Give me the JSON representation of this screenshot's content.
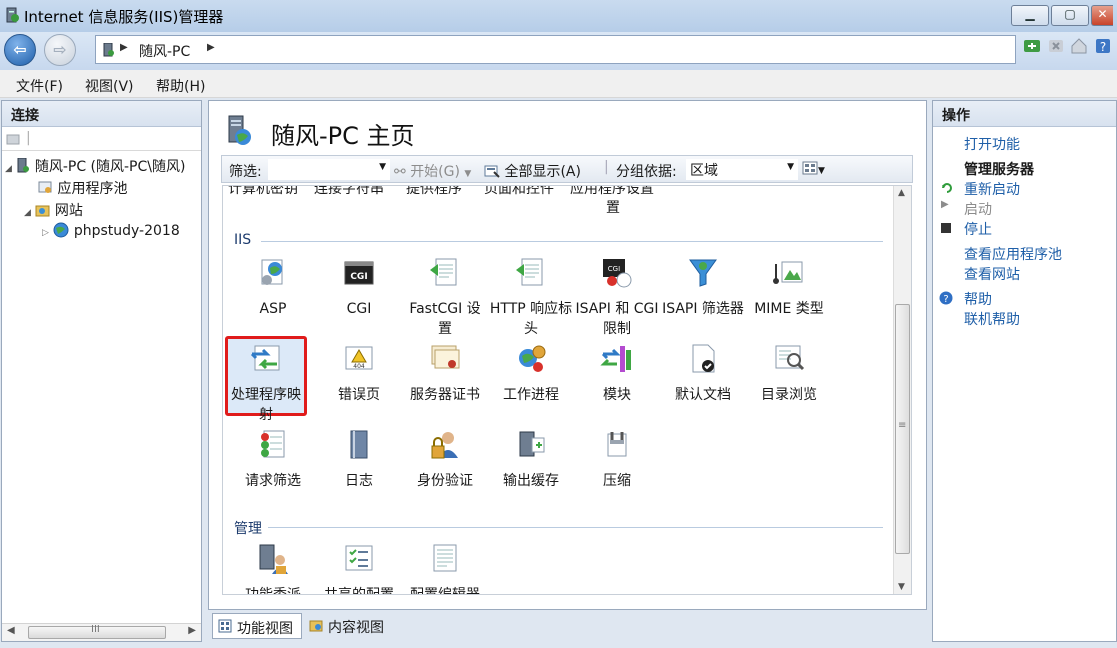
{
  "window": {
    "title": "Internet 信息服务(IIS)管理器"
  },
  "address": {
    "crumbs": [
      "随风-PC"
    ]
  },
  "menu": [
    "文件(F)",
    "视图(V)",
    "帮助(H)"
  ],
  "left": {
    "header": "连接",
    "tree": [
      {
        "label": "随风-PC (随风-PC\\随风)",
        "icon": "server-icon"
      },
      {
        "label": "应用程序池",
        "icon": "app-pool-icon"
      },
      {
        "label": "网站",
        "icon": "sites-folder-icon"
      },
      {
        "label": "phpstudy-2018",
        "icon": "globe-icon"
      }
    ]
  },
  "center": {
    "heading": "随风-PC 主页",
    "filter": {
      "label": "筛选:",
      "start": "开始(G)",
      "show_all": "全部显示(A)",
      "group_by_label": "分组依据:",
      "group_by_value": "区域"
    },
    "top_cut_labels": [
      "计算机密钥",
      "连接字符串",
      "提供程序",
      "页面和控件",
      "应用程序设置"
    ],
    "sections": [
      {
        "title": "IIS",
        "items": [
          {
            "label": "ASP",
            "icon": "asp-icon"
          },
          {
            "label": "CGI",
            "icon": "cgi-icon"
          },
          {
            "label": "FastCGI 设置",
            "icon": "fastcgi-icon"
          },
          {
            "label": "HTTP 响应标头",
            "icon": "http-headers-icon"
          },
          {
            "label": "ISAPI 和 CGI 限制",
            "icon": "isapi-cgi-restrictions-icon"
          },
          {
            "label": "ISAPI 筛选器",
            "icon": "isapi-filters-icon"
          },
          {
            "label": "MIME 类型",
            "icon": "mime-types-icon"
          },
          {
            "label": "处理程序映射",
            "icon": "handler-mappings-icon",
            "selected": true
          },
          {
            "label": "错误页",
            "icon": "error-pages-icon"
          },
          {
            "label": "服务器证书",
            "icon": "server-certificates-icon"
          },
          {
            "label": "工作进程",
            "icon": "worker-processes-icon"
          },
          {
            "label": "模块",
            "icon": "modules-icon"
          },
          {
            "label": "默认文档",
            "icon": "default-document-icon"
          },
          {
            "label": "目录浏览",
            "icon": "directory-browsing-icon"
          },
          {
            "label": "请求筛选",
            "icon": "request-filtering-icon"
          },
          {
            "label": "日志",
            "icon": "logging-icon"
          },
          {
            "label": "身份验证",
            "icon": "authentication-icon"
          },
          {
            "label": "输出缓存",
            "icon": "output-caching-icon"
          },
          {
            "label": "压缩",
            "icon": "compression-icon"
          }
        ]
      },
      {
        "title": "管理",
        "items": [
          {
            "label": "功能委派",
            "icon": "feature-delegation-icon"
          },
          {
            "label": "共享的配置",
            "icon": "shared-configuration-icon"
          },
          {
            "label": "配置编辑器",
            "icon": "configuration-editor-icon"
          }
        ]
      }
    ],
    "view_tabs": [
      "功能视图",
      "内容视图"
    ]
  },
  "actions": {
    "header": "操作",
    "open_feature": "打开功能",
    "manage_server": "管理服务器",
    "restart": "重新启动",
    "start": "启动",
    "stop": "停止",
    "view_app_pools": "查看应用程序池",
    "view_sites": "查看网站",
    "help": "帮助",
    "online_help": "联机帮助"
  },
  "colors": {
    "link": "#1f5fa8",
    "selection_border": "#e01b1b",
    "section_title": "#1e3c6e"
  }
}
